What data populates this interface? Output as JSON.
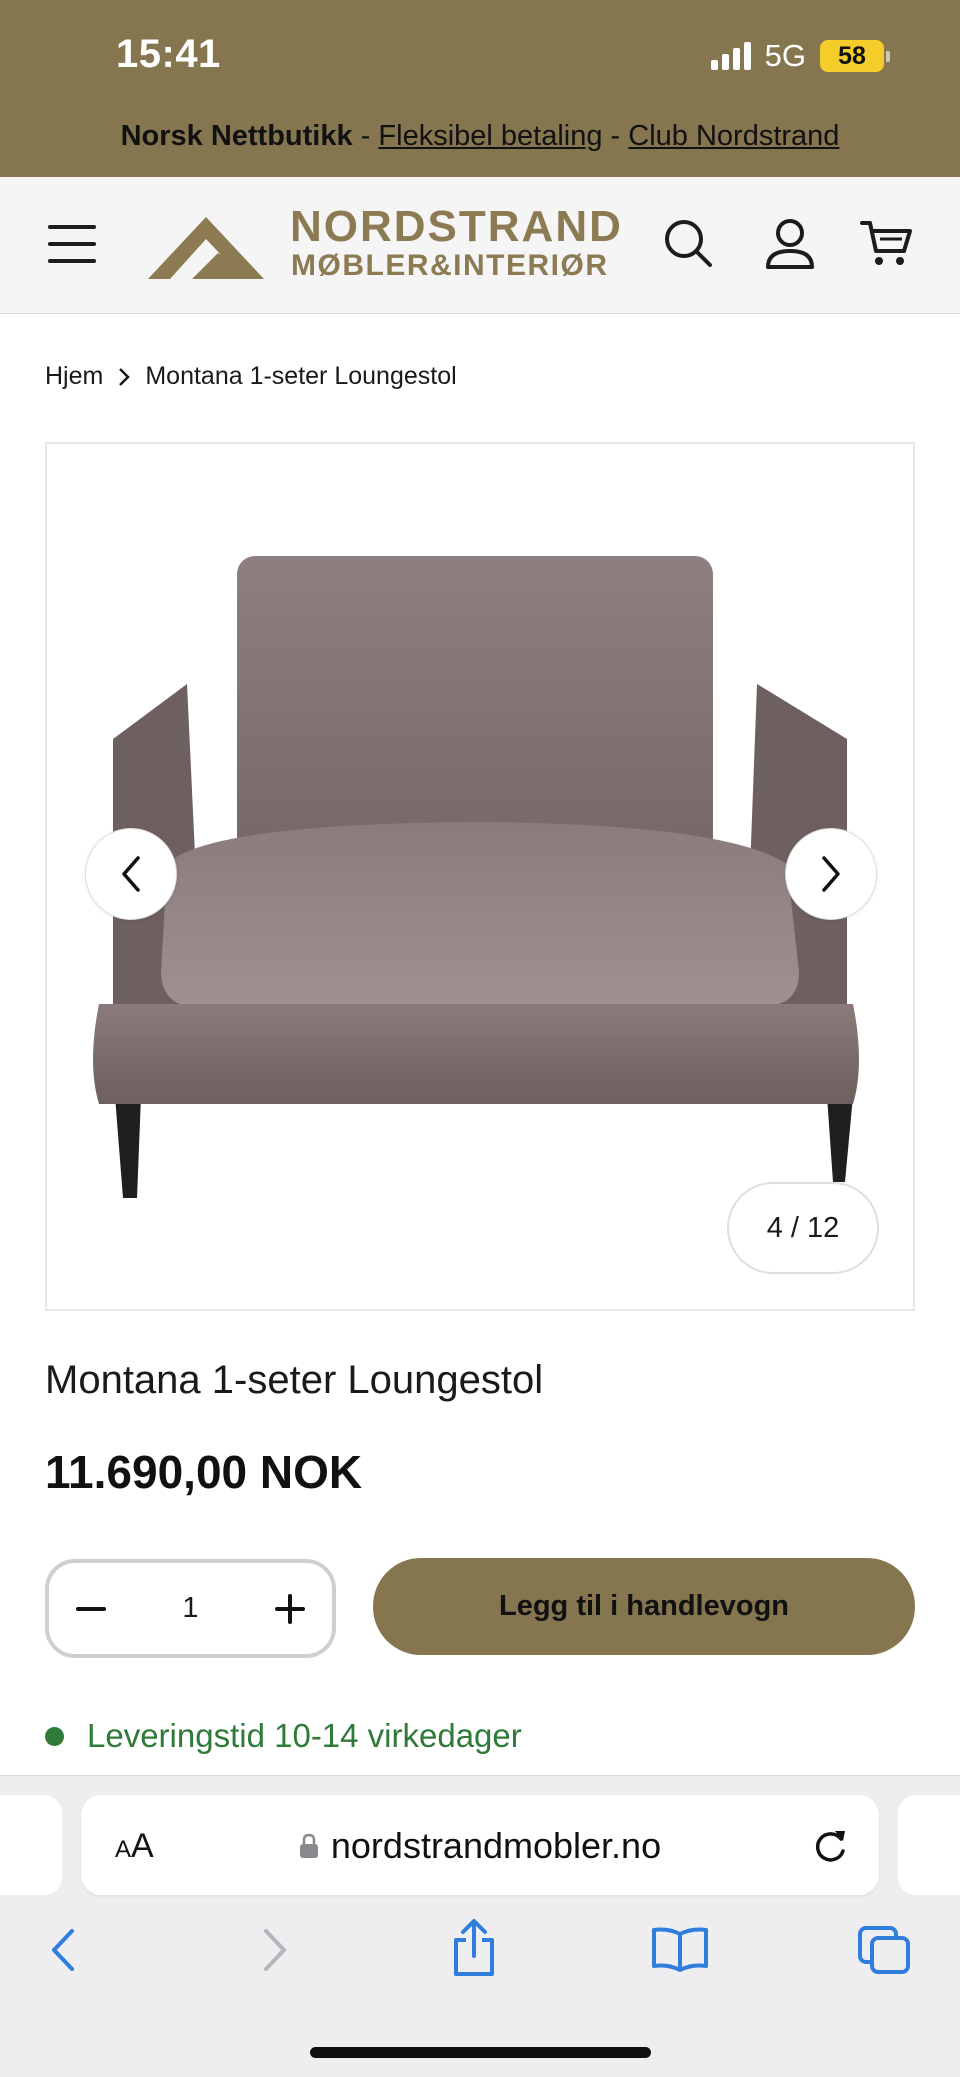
{
  "status_bar": {
    "time": "15:41",
    "network": "5G",
    "battery": "58"
  },
  "promo": {
    "brand": "Norsk Nettbutikk",
    "separator": "-",
    "link1": "Fleksibel betaling",
    "link2": "Club Nordstrand"
  },
  "header": {
    "logo_line1": "NORDSTRAND",
    "logo_line2": "MØBLER&INTERIØR",
    "icons": [
      "menu-icon",
      "search-icon",
      "account-icon",
      "cart-icon"
    ]
  },
  "breadcrumb": {
    "home": "Hjem",
    "current": "Montana 1-seter Loungestol"
  },
  "gallery": {
    "counter": "4 / 12"
  },
  "product": {
    "title": "Montana 1-seter Loungestol",
    "price": "11.690,00 NOK",
    "quantity": "1",
    "add_to_cart": "Legg til i handlevogn",
    "delivery": "Leveringstid 10-14 virkedager"
  },
  "browser": {
    "text_size_label_small": "A",
    "text_size_label_large": "A",
    "url": "nordstrandmobler.no"
  },
  "colors": {
    "brand": "#857650",
    "logo": "#8c7b52",
    "delivery_green": "#2f7a38",
    "safari_blue": "#2f7ddc"
  }
}
